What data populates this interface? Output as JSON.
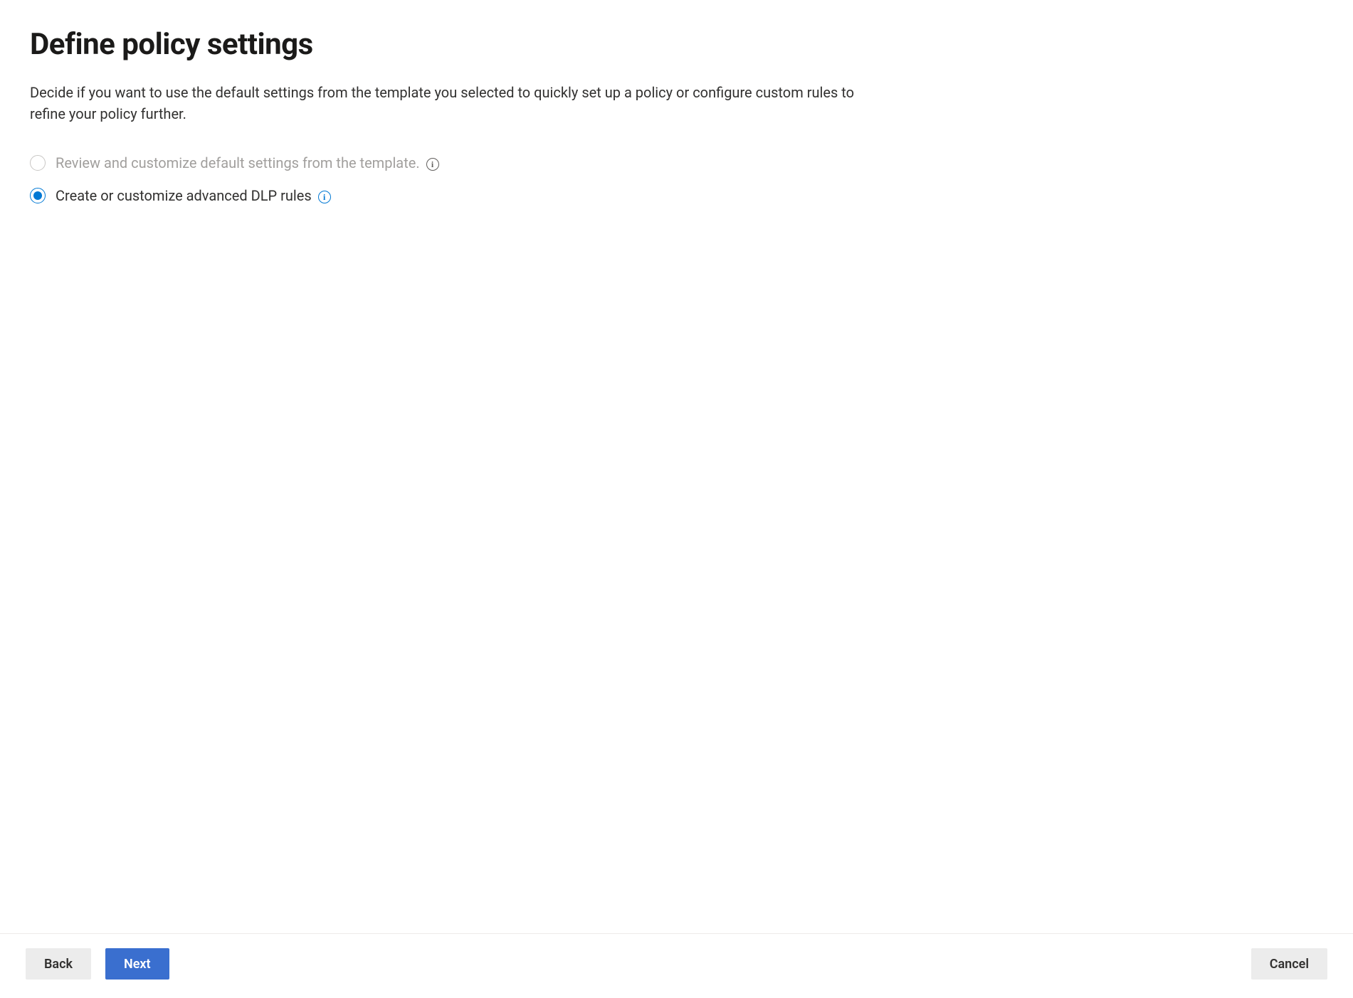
{
  "page": {
    "title": "Define policy settings",
    "description": "Decide if you want to use the default settings from the template you selected to quickly set up a policy or configure custom rules to refine your policy further."
  },
  "options": {
    "review_default": {
      "label": "Review and customize default settings from the template.",
      "disabled": true,
      "selected": false
    },
    "create_advanced": {
      "label": "Create or customize advanced DLP rules",
      "disabled": false,
      "selected": true
    }
  },
  "footer": {
    "back_label": "Back",
    "next_label": "Next",
    "cancel_label": "Cancel"
  }
}
